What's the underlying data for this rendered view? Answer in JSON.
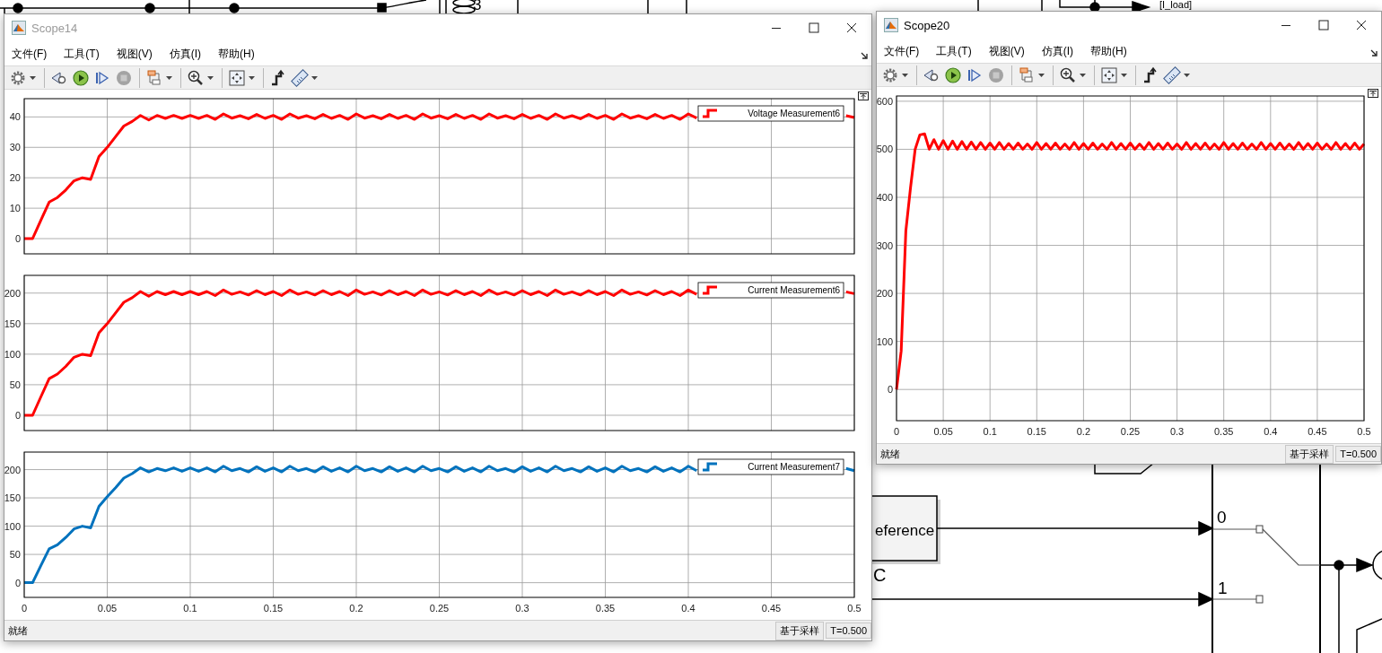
{
  "diagram": {
    "labels": [
      {
        "kind": "block",
        "text": "eference"
      },
      {
        "kind": "port",
        "text": "0"
      },
      {
        "kind": "port",
        "text": "1"
      },
      {
        "kind": "signal",
        "text": "C"
      },
      {
        "kind": "block",
        "text": "3"
      },
      {
        "kind": "goto",
        "text": "[I_load]"
      }
    ]
  },
  "windows": [
    {
      "title": "Scope14",
      "active": false,
      "menu": [
        "文件(F)",
        "工具(T)",
        "视图(V)",
        "仿真(I)",
        "帮助(H)"
      ],
      "toolbar": [
        {
          "kind": "settings",
          "dropdown": true,
          "separator_before": false,
          "disabled": false
        },
        {
          "kind": "step-back",
          "dropdown": false,
          "separator_before": true,
          "disabled": false
        },
        {
          "kind": "run",
          "dropdown": false,
          "separator_before": false,
          "disabled": false
        },
        {
          "kind": "step-forward",
          "dropdown": false,
          "separator_before": false,
          "disabled": false
        },
        {
          "kind": "stop",
          "dropdown": false,
          "separator_before": false,
          "disabled": true
        },
        {
          "kind": "layout",
          "dropdown": true,
          "separator_before": true,
          "disabled": false
        },
        {
          "kind": "zoom",
          "dropdown": true,
          "separator_before": true,
          "disabled": false
        },
        {
          "kind": "fit",
          "dropdown": true,
          "separator_before": true,
          "disabled": false
        },
        {
          "kind": "trigger",
          "dropdown": false,
          "separator_before": true,
          "disabled": false
        },
        {
          "kind": "measure",
          "dropdown": true,
          "separator_before": false,
          "disabled": false
        }
      ],
      "plots": [
        {
          "xtick_labels": false,
          "chart_data": {
            "type": "line",
            "grid": true,
            "xlim": [
              0,
              0.5
            ],
            "ylim": [
              -5,
              46
            ],
            "yticks": [
              0,
              10,
              20,
              30,
              40
            ],
            "x": [
              0,
              0.005,
              0.01,
              0.015,
              0.02,
              0.025,
              0.03,
              0.035,
              0.04,
              0.045,
              0.05,
              0.055,
              0.06,
              0.065,
              0.07,
              0.075,
              0.08,
              0.085,
              0.09,
              0.095,
              0.1,
              0.105,
              0.11,
              0.115,
              0.12,
              0.125,
              0.13,
              0.135,
              0.14,
              0.145,
              0.15,
              0.155,
              0.16,
              0.165,
              0.17,
              0.175,
              0.18,
              0.185,
              0.19,
              0.195,
              0.2,
              0.205,
              0.21,
              0.215,
              0.22,
              0.225,
              0.23,
              0.235,
              0.24,
              0.245,
              0.25,
              0.255,
              0.26,
              0.265,
              0.27,
              0.275,
              0.28,
              0.285,
              0.29,
              0.295,
              0.3,
              0.305,
              0.31,
              0.315,
              0.32,
              0.325,
              0.33,
              0.335,
              0.34,
              0.345,
              0.35,
              0.355,
              0.36,
              0.365,
              0.37,
              0.375,
              0.38,
              0.385,
              0.39,
              0.395,
              0.4,
              0.405,
              0.41,
              0.415,
              0.42,
              0.425,
              0.43,
              0.435,
              0.44,
              0.445,
              0.45,
              0.455,
              0.46,
              0.465,
              0.47,
              0.475,
              0.48,
              0.485,
              0.49,
              0.495,
              0.5
            ],
            "series": [
              {
                "name": "Voltage Measurement6",
                "color": "#ff0000",
                "values": [
                  0,
                  0,
                  6,
                  12,
                  13.5,
                  16,
                  19,
                  20,
                  19.5,
                  27,
                  30,
                  33.5,
                  37,
                  38.5,
                  40.5,
                  39,
                  40.5,
                  39.5,
                  40.5,
                  39.5,
                  40.5,
                  39.5,
                  40.5,
                  39.2,
                  41,
                  39.6,
                  40.4,
                  39.4,
                  40.8,
                  39.5,
                  40.5,
                  39.2,
                  41,
                  39.6,
                  40.4,
                  39.4,
                  40.8,
                  39.5,
                  40.5,
                  39.2,
                  41,
                  39.6,
                  40.4,
                  39.4,
                  40.8,
                  39.5,
                  40.5,
                  39.2,
                  41,
                  39.6,
                  40.4,
                  39.4,
                  40.8,
                  39.5,
                  40.5,
                  39.2,
                  41,
                  39.6,
                  40.4,
                  39.4,
                  40.8,
                  39.5,
                  40.5,
                  39.2,
                  41,
                  39.6,
                  40.4,
                  39.4,
                  40.8,
                  39.5,
                  40.5,
                  39.2,
                  41,
                  39.6,
                  40.4,
                  39.4,
                  40.8,
                  39.5,
                  40.5,
                  39.2,
                  41,
                  39.6,
                  null,
                  null,
                  null,
                  null,
                  null,
                  null,
                  null,
                  null,
                  null,
                  null,
                  null,
                  null,
                  null,
                  null,
                  null,
                  null,
                  null,
                  40.4,
                  39.8
                ]
              }
            ]
          }
        },
        {
          "xtick_labels": false,
          "chart_data": {
            "type": "line",
            "grid": true,
            "xlim": [
              0,
              0.5
            ],
            "ylim": [
              -25,
              229
            ],
            "yticks": [
              0,
              50,
              100,
              150,
              200
            ],
            "x": [
              0,
              0.005,
              0.01,
              0.015,
              0.02,
              0.025,
              0.03,
              0.035,
              0.04,
              0.045,
              0.05,
              0.055,
              0.06,
              0.065,
              0.07,
              0.075,
              0.08,
              0.085,
              0.09,
              0.095,
              0.1,
              0.105,
              0.11,
              0.115,
              0.12,
              0.125,
              0.13,
              0.135,
              0.14,
              0.145,
              0.15,
              0.155,
              0.16,
              0.165,
              0.17,
              0.175,
              0.18,
              0.185,
              0.19,
              0.195,
              0.2,
              0.205,
              0.21,
              0.215,
              0.22,
              0.225,
              0.23,
              0.235,
              0.24,
              0.245,
              0.25,
              0.255,
              0.26,
              0.265,
              0.27,
              0.275,
              0.28,
              0.285,
              0.29,
              0.295,
              0.3,
              0.305,
              0.31,
              0.315,
              0.32,
              0.325,
              0.33,
              0.335,
              0.34,
              0.345,
              0.35,
              0.355,
              0.36,
              0.365,
              0.37,
              0.375,
              0.38,
              0.385,
              0.39,
              0.395,
              0.4,
              0.405,
              0.41,
              0.415,
              0.42,
              0.425,
              0.43,
              0.435,
              0.44,
              0.445,
              0.45,
              0.455,
              0.46,
              0.465,
              0.47,
              0.475,
              0.48,
              0.485,
              0.49,
              0.495,
              0.5
            ],
            "series": [
              {
                "name": "Current Measurement6",
                "color": "#ff0000",
                "values": [
                  0,
                  0,
                  30,
                  60,
                  67.5,
                  80,
                  95,
                  100,
                  97.5,
                  135,
                  150,
                  167.5,
                  185,
                  192.5,
                  202.5,
                  195,
                  202.5,
                  197.5,
                  202.5,
                  197.5,
                  202.5,
                  197.5,
                  202.5,
                  196,
                  205,
                  198,
                  202,
                  197,
                  204,
                  197.5,
                  202.5,
                  196,
                  205,
                  198,
                  202,
                  197,
                  204,
                  197.5,
                  202.5,
                  196,
                  205,
                  198,
                  202,
                  197,
                  204,
                  197.5,
                  202.5,
                  196,
                  205,
                  198,
                  202,
                  197,
                  204,
                  197.5,
                  202.5,
                  196,
                  205,
                  198,
                  202,
                  197,
                  204,
                  197.5,
                  202.5,
                  196,
                  205,
                  198,
                  202,
                  197,
                  204,
                  197.5,
                  202.5,
                  196,
                  205,
                  198,
                  202,
                  197,
                  204,
                  197.5,
                  202.5,
                  196,
                  205,
                  198,
                  null,
                  null,
                  null,
                  null,
                  null,
                  null,
                  null,
                  null,
                  null,
                  null,
                  null,
                  null,
                  null,
                  null,
                  null,
                  null,
                  null,
                  202,
                  199
                ]
              }
            ]
          }
        },
        {
          "xtick_labels": true,
          "chart_data": {
            "type": "line",
            "grid": true,
            "xlim": [
              0,
              0.5
            ],
            "ylim": [
              -26,
              231
            ],
            "xticks": [
              0,
              0.05,
              0.1,
              0.15,
              0.2,
              0.25,
              0.3,
              0.35,
              0.4,
              0.45,
              0.5
            ],
            "yticks": [
              0,
              50,
              100,
              150,
              200
            ],
            "x": [
              0,
              0.005,
              0.01,
              0.015,
              0.02,
              0.025,
              0.03,
              0.035,
              0.04,
              0.045,
              0.05,
              0.055,
              0.06,
              0.065,
              0.07,
              0.075,
              0.08,
              0.085,
              0.09,
              0.095,
              0.1,
              0.105,
              0.11,
              0.115,
              0.12,
              0.125,
              0.13,
              0.135,
              0.14,
              0.145,
              0.15,
              0.155,
              0.16,
              0.165,
              0.17,
              0.175,
              0.18,
              0.185,
              0.19,
              0.195,
              0.2,
              0.205,
              0.21,
              0.215,
              0.22,
              0.225,
              0.23,
              0.235,
              0.24,
              0.245,
              0.25,
              0.255,
              0.26,
              0.265,
              0.27,
              0.275,
              0.28,
              0.285,
              0.29,
              0.295,
              0.3,
              0.305,
              0.31,
              0.315,
              0.32,
              0.325,
              0.33,
              0.335,
              0.34,
              0.345,
              0.35,
              0.355,
              0.36,
              0.365,
              0.37,
              0.375,
              0.38,
              0.385,
              0.39,
              0.395,
              0.4,
              0.405,
              0.41,
              0.415,
              0.42,
              0.425,
              0.43,
              0.435,
              0.44,
              0.445,
              0.45,
              0.455,
              0.46,
              0.465,
              0.47,
              0.475,
              0.48,
              0.485,
              0.49,
              0.495,
              0.5
            ],
            "series": [
              {
                "name": "Current Measurement7",
                "color": "#0072bd",
                "values": [
                  0,
                  0,
                  30,
                  60,
                  67,
                  80,
                  95,
                  100,
                  97,
                  135,
                  152,
                  168,
                  185,
                  193,
                  203,
                  196,
                  202,
                  198,
                  203,
                  197,
                  203,
                  197,
                  203,
                  196,
                  206,
                  198,
                  202,
                  196,
                  205,
                  197,
                  203,
                  196,
                  206,
                  198,
                  202,
                  196,
                  205,
                  197,
                  203,
                  196,
                  206,
                  198,
                  202,
                  196,
                  205,
                  197,
                  203,
                  196,
                  206,
                  198,
                  202,
                  196,
                  205,
                  197,
                  203,
                  196,
                  206,
                  198,
                  202,
                  196,
                  205,
                  197,
                  203,
                  196,
                  206,
                  198,
                  202,
                  196,
                  205,
                  197,
                  203,
                  196,
                  206,
                  198,
                  202,
                  196,
                  205,
                  197,
                  203,
                  196,
                  206,
                  198,
                  null,
                  null,
                  null,
                  null,
                  null,
                  null,
                  null,
                  null,
                  null,
                  null,
                  null,
                  null,
                  null,
                  null,
                  null,
                  null,
                  null,
                  202,
                  198
                ]
              }
            ]
          }
        }
      ],
      "status": {
        "text": "就绪",
        "mode": "基于采样",
        "time": "T=0.500"
      }
    },
    {
      "title": "Scope20",
      "active": true,
      "menu": [
        "文件(F)",
        "工具(T)",
        "视图(V)",
        "仿真(I)",
        "帮助(H)"
      ],
      "toolbar": [
        {
          "kind": "settings",
          "dropdown": true,
          "separator_before": false,
          "disabled": false
        },
        {
          "kind": "step-back",
          "dropdown": false,
          "separator_before": true,
          "disabled": false
        },
        {
          "kind": "run",
          "dropdown": false,
          "separator_before": false,
          "disabled": false
        },
        {
          "kind": "step-forward",
          "dropdown": false,
          "separator_before": false,
          "disabled": false
        },
        {
          "kind": "stop",
          "dropdown": false,
          "separator_before": false,
          "disabled": true
        },
        {
          "kind": "layout",
          "dropdown": true,
          "separator_before": true,
          "disabled": false
        },
        {
          "kind": "zoom",
          "dropdown": true,
          "separator_before": true,
          "disabled": false
        },
        {
          "kind": "fit",
          "dropdown": true,
          "separator_before": true,
          "disabled": false
        },
        {
          "kind": "trigger",
          "dropdown": false,
          "separator_before": true,
          "disabled": false
        },
        {
          "kind": "measure",
          "dropdown": true,
          "separator_before": false,
          "disabled": false
        }
      ],
      "plots": [
        {
          "xtick_labels": true,
          "chart_data": {
            "type": "line",
            "grid": true,
            "xlim": [
              0,
              0.5
            ],
            "ylim": [
              -65,
              611
            ],
            "xticks": [
              0,
              0.05,
              0.1,
              0.15,
              0.2,
              0.25,
              0.3,
              0.35,
              0.4,
              0.45,
              0.5
            ],
            "yticks": [
              0,
              100,
              200,
              300,
              400,
              500,
              600
            ],
            "x": [
              0,
              0.005,
              0.01,
              0.015,
              0.02,
              0.025,
              0.03,
              0.035,
              0.04,
              0.045,
              0.05,
              0.055,
              0.06,
              0.065,
              0.07,
              0.075,
              0.08,
              0.085,
              0.09,
              0.095,
              0.1,
              0.105,
              0.11,
              0.115,
              0.12,
              0.125,
              0.13,
              0.135,
              0.14,
              0.145,
              0.15,
              0.155,
              0.16,
              0.165,
              0.17,
              0.175,
              0.18,
              0.185,
              0.19,
              0.195,
              0.2,
              0.205,
              0.21,
              0.215,
              0.22,
              0.225,
              0.23,
              0.235,
              0.24,
              0.245,
              0.25,
              0.255,
              0.26,
              0.265,
              0.27,
              0.275,
              0.28,
              0.285,
              0.29,
              0.295,
              0.3,
              0.305,
              0.31,
              0.315,
              0.32,
              0.325,
              0.33,
              0.335,
              0.34,
              0.345,
              0.35,
              0.355,
              0.36,
              0.365,
              0.37,
              0.375,
              0.38,
              0.385,
              0.39,
              0.395,
              0.4,
              0.405,
              0.41,
              0.415,
              0.42,
              0.425,
              0.43,
              0.435,
              0.44,
              0.445,
              0.45,
              0.455,
              0.46,
              0.465,
              0.47,
              0.475,
              0.48,
              0.485,
              0.49,
              0.495,
              0.5
            ],
            "series": [
              {
                "color": "#ff0000",
                "values": [
                  0,
                  80,
                  330,
                  420,
                  500,
                  530,
                  532,
                  500,
                  520,
                  500,
                  518,
                  500,
                  517,
                  500,
                  516,
                  500,
                  515,
                  500,
                  514,
                  500,
                  513,
                  500,
                  514,
                  500,
                  512,
                  500,
                  513,
                  500,
                  511,
                  500,
                  514,
                  500,
                  512,
                  500,
                  513,
                  500,
                  511,
                  500,
                  514,
                  500,
                  512,
                  500,
                  513,
                  500,
                  511,
                  500,
                  514,
                  500,
                  512,
                  500,
                  513,
                  500,
                  511,
                  500,
                  514,
                  500,
                  512,
                  500,
                  513,
                  500,
                  511,
                  500,
                  514,
                  500,
                  512,
                  500,
                  513,
                  500,
                  511,
                  500,
                  514,
                  500,
                  512,
                  500,
                  513,
                  500,
                  511,
                  500,
                  514,
                  500,
                  512,
                  500,
                  513,
                  500,
                  511,
                  500,
                  514,
                  500,
                  512,
                  500,
                  513,
                  500,
                  511,
                  500,
                  514,
                  500,
                  512,
                  500,
                  513,
                  500,
                  511
                ]
              }
            ]
          }
        }
      ],
      "status": {
        "text": "就绪",
        "mode": "基于采样",
        "time": "T=0.500"
      }
    }
  ]
}
